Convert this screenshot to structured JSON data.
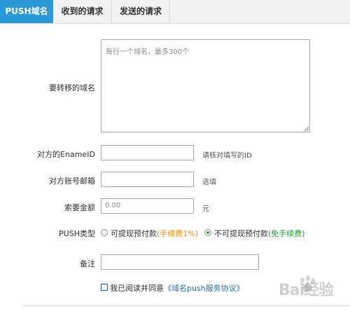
{
  "tabs": [
    {
      "label": "PUSH域名",
      "active": true
    },
    {
      "label": "收到的请求",
      "active": false
    },
    {
      "label": "发送的请求",
      "active": false
    }
  ],
  "form": {
    "domains": {
      "label": "要转移的域名",
      "placeholder": "每行一个域名，最多300个"
    },
    "ename_id": {
      "label": "对方的EnameID",
      "hint": "请核对填写的ID",
      "value": ""
    },
    "email": {
      "label": "对方账号邮箱",
      "hint": "选填",
      "value": ""
    },
    "amount": {
      "label": "索要金额",
      "placeholder": "0.00",
      "unit": "元"
    },
    "push_type": {
      "label": "PUSH类型",
      "options": [
        {
          "text": "可提现预付款",
          "fee": "(手续费1%)",
          "selected": false
        },
        {
          "text": "不可提现预付款",
          "fee": "(免手续费)",
          "selected": true
        }
      ]
    },
    "remark": {
      "label": "备注",
      "value": ""
    },
    "agreement": {
      "prefix": "我已阅读并同意",
      "link": "《域名push服务协议》",
      "checked": false
    }
  },
  "watermark": {
    "text": "Bai经验"
  },
  "colors": {
    "tab_active": "#2b99d6",
    "fee_orange": "#f08c00",
    "fee_green": "#1f9c2a",
    "link": "#1a6fb4"
  }
}
